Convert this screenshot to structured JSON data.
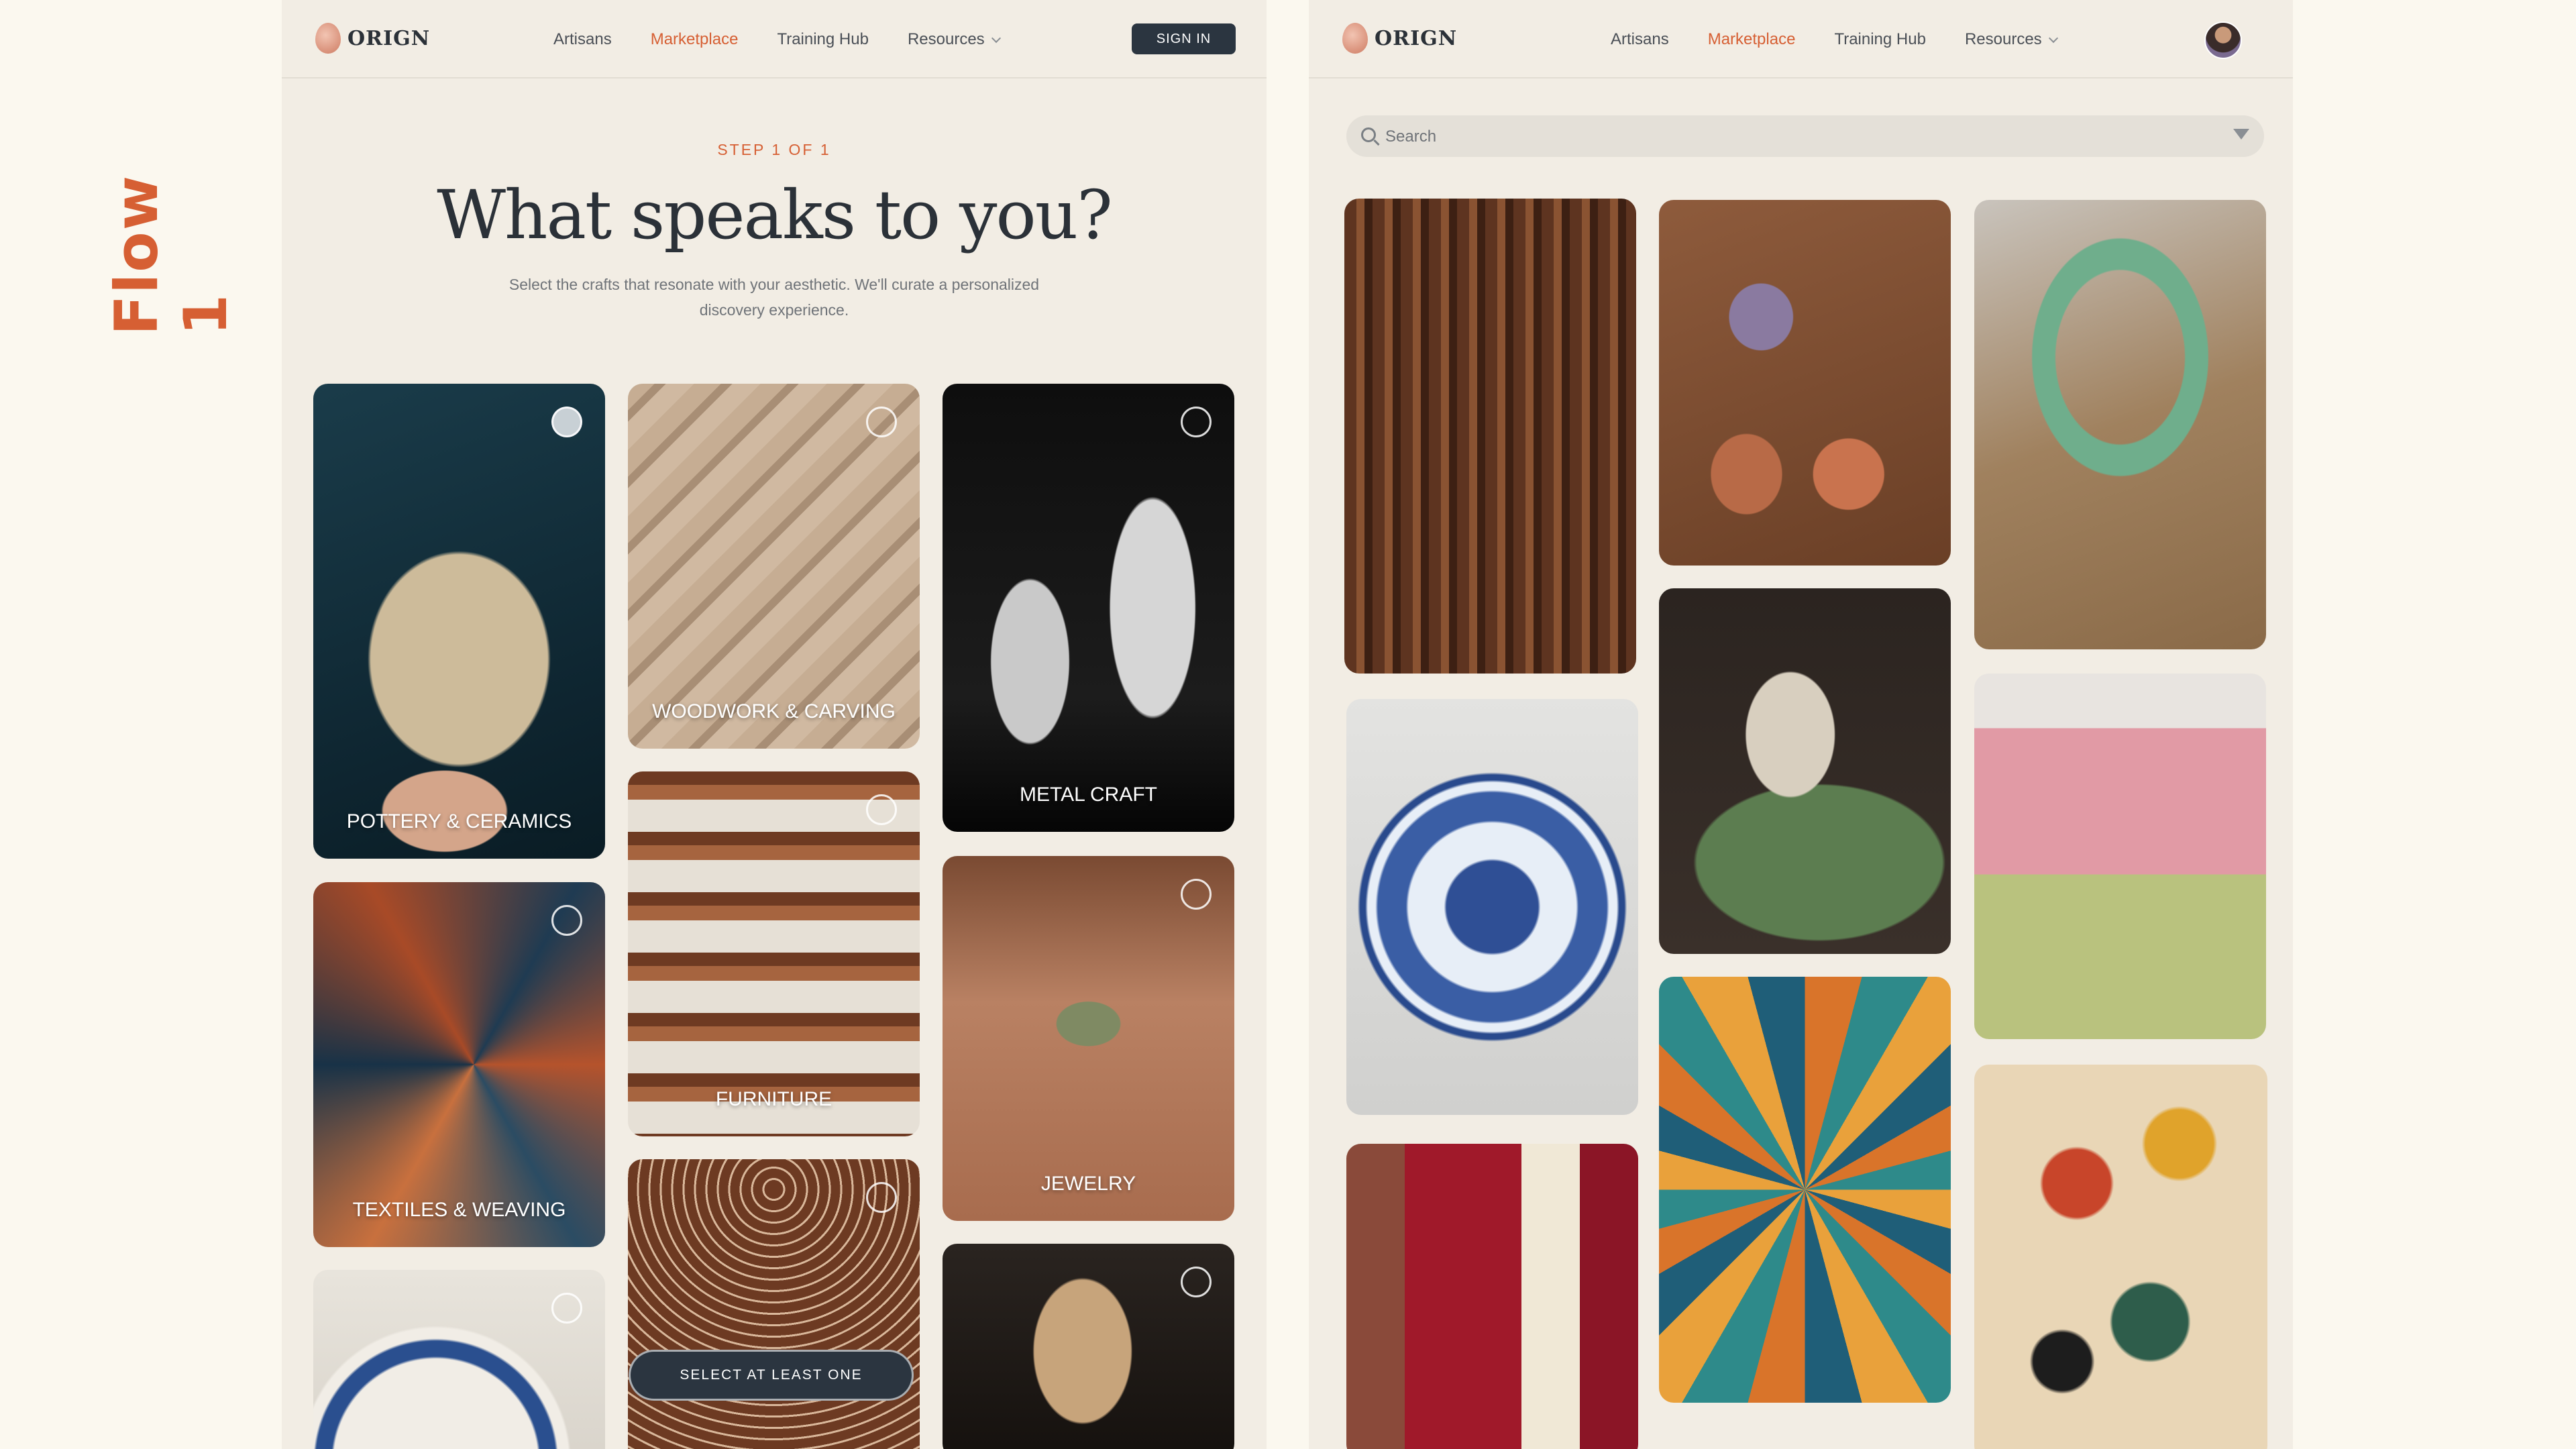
{
  "flow_label": "Flow 1",
  "brand": {
    "logo_text": "ORIGN"
  },
  "nav": {
    "links": [
      "Artisans",
      "Marketplace",
      "Training Hub",
      "Resources"
    ],
    "active": "Marketplace",
    "signin_label": "SIGN IN"
  },
  "onboarding": {
    "step": "STEP 1 OF 1",
    "title": "What speaks to you?",
    "subtitle": "Select the crafts that resonate with your aesthetic. We'll curate a personalized discovery experience.",
    "categories": [
      {
        "label": "POTTERY & CERAMICS",
        "selected": true
      },
      {
        "label": "WOODWORK & CARVING",
        "selected": false
      },
      {
        "label": "METAL CRAFT",
        "selected": false
      },
      {
        "label": "TEXTILES & WEAVING",
        "selected": false
      },
      {
        "label": "FURNITURE",
        "selected": false
      },
      {
        "label": "JEWELRY",
        "selected": false
      }
    ],
    "cta_label": "SELECT AT LEAST ONE"
  },
  "marketplace": {
    "search_placeholder": "Search",
    "items": [
      "carved-wooden-shrine",
      "painted-wooden-trays",
      "kundan-necklace",
      "blue-pottery-plate",
      "frog-incense-holder",
      "pink-green-saree",
      "red-lehenga",
      "painted-tiles",
      "kalamkari-textile"
    ]
  },
  "colors": {
    "accent": "#d65f33",
    "panel_bg": "#f2ede4",
    "page_bg": "#fbf8ef",
    "dark_button": "#2b3540"
  }
}
